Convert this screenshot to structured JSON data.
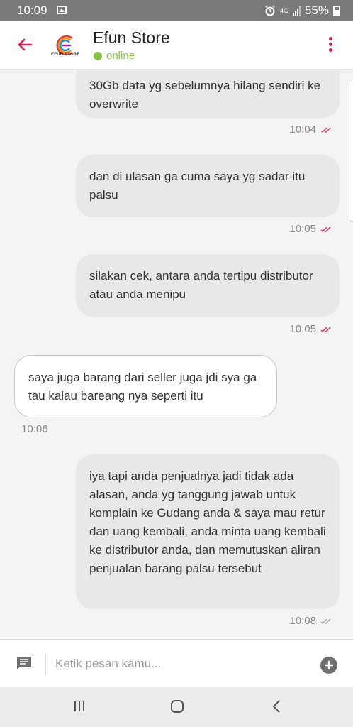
{
  "status_bar": {
    "time": "10:09",
    "network": "4G",
    "battery": "55%",
    "icons": [
      "gallery-icon",
      "alarm-icon",
      "signal-icon",
      "battery-icon"
    ]
  },
  "header": {
    "title": "Efun Store",
    "logo_text": "EFUN STORE",
    "status": "online",
    "accent_color": "#e0195a",
    "status_color": "#8bc34a",
    "icons": [
      "back-arrow-icon",
      "more-vert-icon"
    ]
  },
  "messages": [
    {
      "direction": "out",
      "text": "30Gb data yg sebelumnya hilang sendiri ke overwrite",
      "time": "10:04",
      "status": "read"
    },
    {
      "direction": "out",
      "text": "dan di ulasan ga cuma saya yg sadar itu palsu",
      "time": "10:05",
      "status": "read"
    },
    {
      "direction": "out",
      "text": "silakan cek, antara anda tertipu distributor atau anda menipu",
      "time": "10:05",
      "status": "read"
    },
    {
      "direction": "in",
      "text": "saya juga barang dari seller juga jdi sya ga tau kalau bareang nya seperti itu",
      "time": "10:06"
    },
    {
      "direction": "out",
      "text": "iya tapi anda penjualnya jadi tidak ada alasan, anda yg tanggung jawab untuk komplain ke Gudang anda & saya mau retur dan uang kembali, anda minta uang kembali ke distributor anda, dan memutuskan aliran penjualan barang palsu tersebut",
      "time": "10:08",
      "status": "delivered"
    }
  ],
  "input": {
    "placeholder": "Ketik pesan kamu..."
  }
}
